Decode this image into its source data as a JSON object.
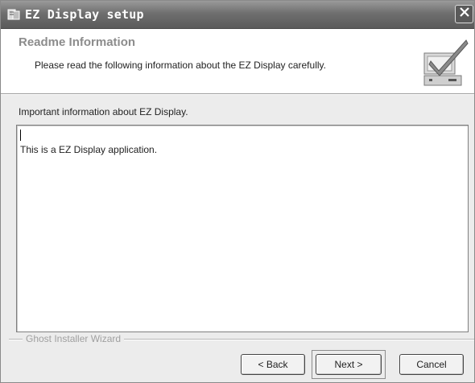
{
  "window": {
    "title": "EZ Display setup",
    "icons": {
      "app": "setup-app-icon",
      "close": "close-icon",
      "header": "checkmark-install-icon"
    }
  },
  "header": {
    "title": "Readme Information",
    "subtitle": "Please read the following information about the EZ Display carefully."
  },
  "main": {
    "label": "Important information about EZ Display.",
    "textbox_content": "This is a EZ Display application."
  },
  "footer": {
    "group_label": "Ghost Installer Wizard",
    "buttons": {
      "back": "< Back",
      "next": "Next >",
      "cancel": "Cancel"
    }
  }
}
